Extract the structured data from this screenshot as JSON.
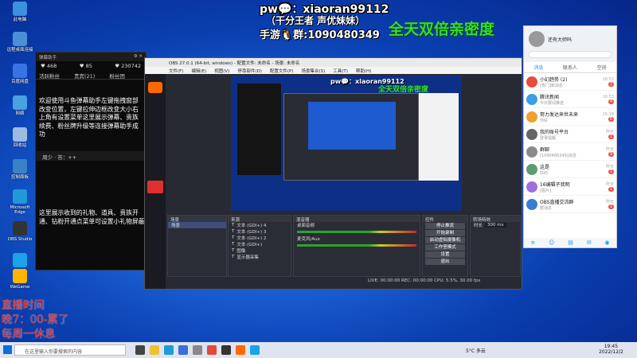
{
  "overlay": {
    "pw_line": "pw💬：xiaoran99112",
    "sub_line": "（干分王者 声优妹妹）",
    "mobile_line": "手游🐧群:1090480349",
    "big_title": "全天双倍亲密度",
    "schedule": [
      "直播时间",
      "晚7：00-累了",
      "每周一休息"
    ]
  },
  "desktop_icons": [
    {
      "label": "此电脑",
      "icon": "computer-icon",
      "color": "#3d8fe0"
    },
    {
      "label": "远程桌面连接",
      "icon": "remote-icon",
      "color": "#4a90d9"
    },
    {
      "label": "百度网盘",
      "icon": "netdisk-icon",
      "color": "#3874e6"
    },
    {
      "label": "网络",
      "icon": "network-icon",
      "color": "#4aa0e0"
    },
    {
      "label": "回收站",
      "icon": "recycle-icon",
      "color": "#9dbbe0"
    },
    {
      "label": "控制面板",
      "icon": "control-panel-icon",
      "color": "#3b82c4"
    },
    {
      "label": "Microsoft Edge",
      "icon": "edge-icon",
      "color": "#1f9ad6"
    },
    {
      "label": "OBS Studio",
      "icon": "obs-icon",
      "color": "#333333"
    },
    {
      "label": "QQ",
      "icon": "qq-icon",
      "color": "#1aa3e8"
    },
    {
      "label": "WeGame",
      "icon": "wegame-icon",
      "color": "#ffb400"
    }
  ],
  "danmu": {
    "header": "弹幕助手",
    "stats": [
      "♥ 468",
      "♥ 85",
      "♥ 230742"
    ],
    "tabs": [
      "活跃粉丝",
      "贵宾(21)",
      "粉丝团"
    ],
    "messages": "欢迎使用斗鱼弹幕助手左键拖拽窗部改变位置，左键拉伸边框改变大小右上角有设置菜单这里展示弹幕、贵族续费、粉丝牌升级等连接弹幕助手成功",
    "user_row": "周少 · 答：++",
    "messages2": "这里展示收到的礼物、道具、贵族开通、钻粉开通点菜单可设置小礼物屏蔽"
  },
  "obs": {
    "title": "OBS 27.0.1 (64-bit, windows) - 配置文件: 未命名 - 场景: 未命名",
    "menu": [
      "文件(F)",
      "编辑(E)",
      "视图(V)",
      "停靠部件(D)",
      "配置文件(P)",
      "场景集合(S)",
      "工具(T)",
      "帮助(H)"
    ],
    "panels": {
      "scenes": "场景",
      "sources": "来源",
      "mixer": "混音器",
      "transitions": "转场特效",
      "controls": "控件"
    },
    "scene_item": "场景",
    "sources": [
      "文本 (GDI+) 4",
      "文本 (GDI+) 3",
      "文本 (GDI+) 2",
      "文本 (GDI+)",
      "图像",
      "显示器采集"
    ],
    "mixer": [
      "桌面音频",
      "麦克风/Aux"
    ],
    "controls": [
      "停止推流",
      "开始录制",
      "启动虚拟摄像机",
      "工作室模式",
      "设置",
      "退出"
    ],
    "duration_label": "时长",
    "duration_value": "300 ms",
    "statusbar": "LIVE: 00:00:00  REC: 00:00:00  CPU: 5.5%, 30.00 fps",
    "preview_text": "全天双倍亲密度"
  },
  "qq": {
    "username": "还有大师吗",
    "tabs": [
      "消息",
      "联系人",
      "空间"
    ],
    "conversations": [
      {
        "name": "小幻趋势 (2)",
        "msg": "[热门]新消息",
        "time": "16:53",
        "badge": "2",
        "color": "#e84c3d"
      },
      {
        "name": "腾讯新闻",
        "msg": "今日要闻推送",
        "time": "16:53",
        "badge": "4",
        "color": "#3aa0e8"
      },
      {
        "name": "努力发达来世未来",
        "msg": "你好",
        "time": "15:18",
        "badge": "6",
        "color": "#f0a030"
      },
      {
        "name": "我的账号平台",
        "msg": "登录提醒",
        "time": "昨天",
        "badge": "1",
        "color": "#666666"
      },
      {
        "name": "群聊",
        "msg": "[1090480349]消息",
        "time": "昨天",
        "badge": "9",
        "color": "#8a8a8a"
      },
      {
        "name": "这是",
        "msg": "好的",
        "time": "昨天",
        "badge": "1",
        "color": "#5a9e6f"
      },
      {
        "name": "16编辑子我明",
        "msg": "[图片]",
        "time": "昨天",
        "badge": "1",
        "color": "#a06ee0"
      },
      {
        "name": "OBS直播交流群",
        "msg": "群消息",
        "time": "昨天",
        "badge": "1",
        "color": "#3a7bd5"
      }
    ]
  },
  "taskbar": {
    "search_placeholder": "在这里输入你要搜索的内容",
    "weather": "5°C 多云",
    "time": "19:45",
    "date": "2022/12/2"
  }
}
